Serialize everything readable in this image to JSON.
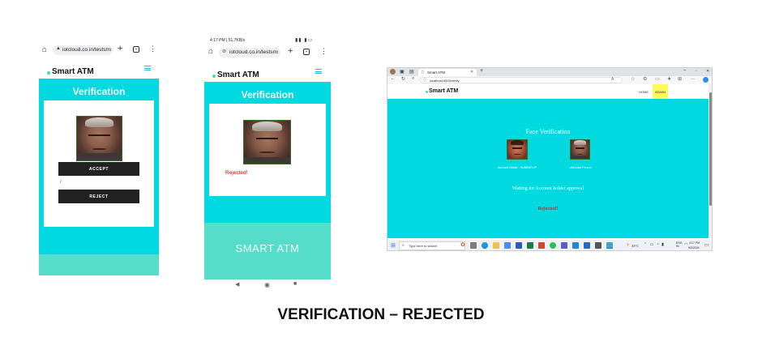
{
  "phone1": {
    "url": "iotcloud.co.in/testsms",
    "brand": "Smart ATM",
    "heading": "Verification",
    "accept_label": "ACCEPT",
    "slash": "/",
    "reject_label": "REJECT"
  },
  "phone2": {
    "status_time": "4:17 PM | 51.7KB/s",
    "url": "iotcloud.co.in/testsms",
    "brand": "Smart ATM",
    "heading": "Verification",
    "status": "Rejected!",
    "footer": "SMART ATM"
  },
  "desktop": {
    "tab_title": "Smart ATM",
    "url": "localhost:5000/verify",
    "brand": "Smart ATM",
    "nav": [
      "HOME",
      "ADMIN"
    ],
    "heading": "Face Verification",
    "holder_label": "Account Holder : SUBRATH P",
    "unknown_label": "Unknown Person",
    "waiting": "Waiting for Account holder approval",
    "status": "Rejected!",
    "search_placeholder": "Type here to search",
    "weather": "33°C",
    "lang": "ENG\nIN",
    "clock_time": "4:17 PM",
    "clock_date": "5/3/2024"
  },
  "caption": "VERIFICATION – REJECTED",
  "colors": {
    "teal": "#00d9e0",
    "mint": "#55ddca",
    "dark_button": "#222222",
    "reject_red": "#d80000",
    "admin_yellow": "#fcf95c"
  }
}
